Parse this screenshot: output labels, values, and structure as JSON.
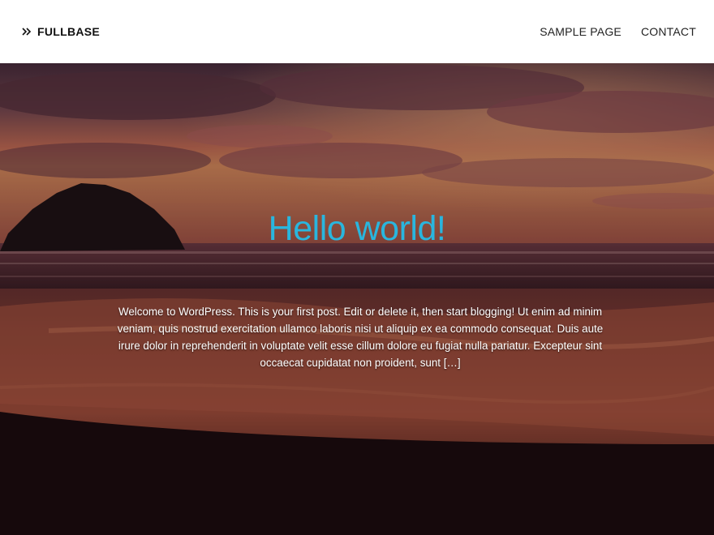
{
  "site": {
    "title": "FULLBASE",
    "icon": "double-chevron-right-icon"
  },
  "nav": {
    "items": [
      {
        "label": "SAMPLE PAGE"
      },
      {
        "label": "CONTACT"
      }
    ]
  },
  "post": {
    "title": "Hello world!",
    "excerpt": "Welcome to WordPress. This is your first post. Edit or delete it, then start blogging!  Ut enim ad minim veniam, quis nostrud exercitation ullamco laboris nisi ut aliquip ex ea commodo consequat. Duis aute irure dolor in reprehenderit in voluptate velit esse cillum dolore eu fugiat nulla pariatur. Excepteur sint occaecat cupidatat non proident, sunt […]"
  },
  "colors": {
    "header_bg": "#ffffff",
    "title_accent": "#29b6de",
    "text_on_image": "#ffffff"
  }
}
